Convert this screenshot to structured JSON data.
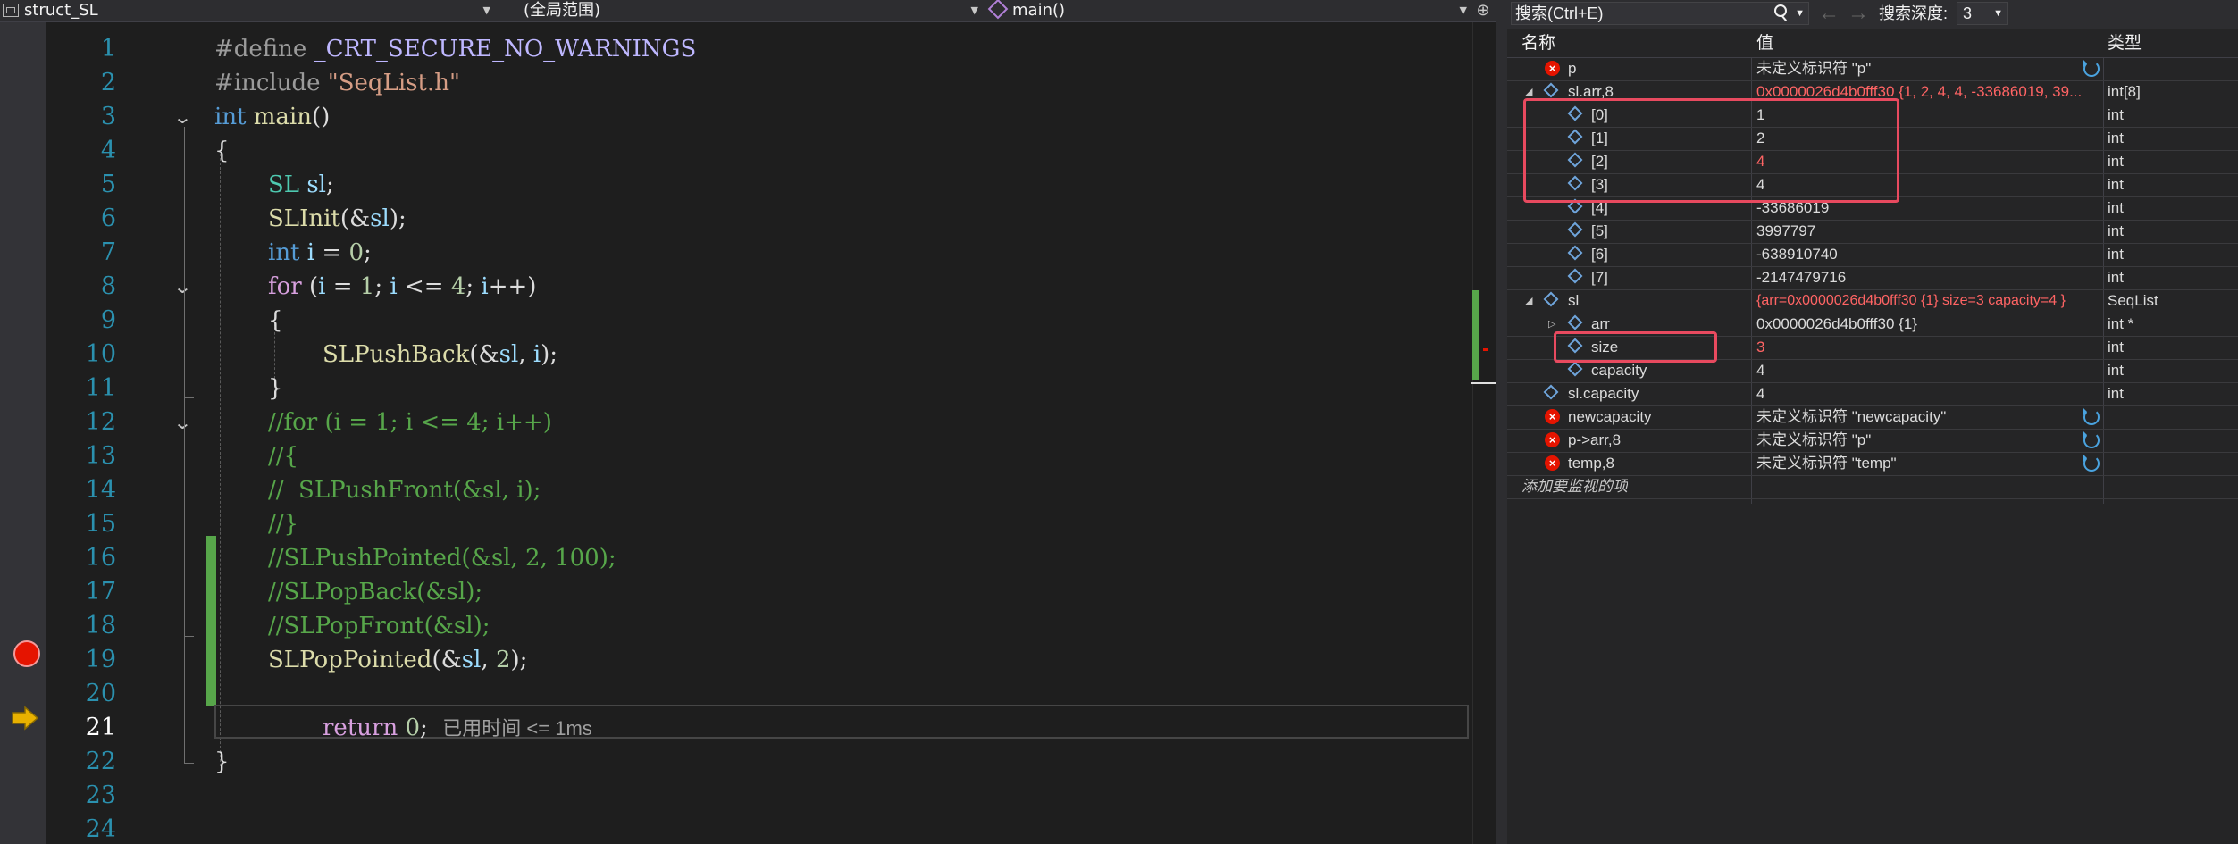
{
  "navigation": {
    "project": "struct_SL",
    "scope": "(全局范围)",
    "function": "main()"
  },
  "editor": {
    "line_numbers": [
      "1",
      "2",
      "3",
      "4",
      "5",
      "6",
      "7",
      "8",
      "9",
      "10",
      "11",
      "12",
      "13",
      "14",
      "15",
      "16",
      "17",
      "18",
      "19",
      "20",
      "21",
      "22",
      "23",
      "24"
    ],
    "current_line": "21",
    "breakpoint_line": "19",
    "elapsed": "已用时间 <= 1ms",
    "code": {
      "l1_define": "#define",
      "l1_macro": "_CRT_SECURE_NO_WARNINGS",
      "l2_include": "#include",
      "l2_file": "\"SeqList.h\"",
      "l3_type": "int",
      "l3_func": "main",
      "l3_rest": "()",
      "l4": "{",
      "l5_type": "SL",
      "l5_var": "sl",
      "l5_rest": ";",
      "l6_func": "SLInit",
      "l6_open": "(&",
      "l6_var": "sl",
      "l6_close": ");",
      "l7_type": "int",
      "l7_var": "i",
      "l7_eq": " = ",
      "l7_num": "0",
      "l7_end": ";",
      "l8_kw": "for",
      "l8_a": " (",
      "l8_i1": "i",
      "l8_b": " = ",
      "l8_n1": "1",
      "l8_c": "; ",
      "l8_i2": "i",
      "l8_d": " <= ",
      "l8_n2": "4",
      "l8_e": "; ",
      "l8_i3": "i",
      "l8_f": "++)",
      "l9": "{",
      "l10_func": "SLPushBack",
      "l10_open": "(&",
      "l10_var": "sl",
      "l10_comma": ", ",
      "l10_i": "i",
      "l10_close": ");",
      "l11": "}",
      "l12": "//for (i = 1; i <= 4; i++)",
      "l13": "//{",
      "l14": "//  SLPushFront(&sl, i);",
      "l15": "//}",
      "l16": "//SLPushPointed(&sl, 2, 100);",
      "l17": "//SLPopBack(&sl);",
      "l18": "//SLPopFront(&sl);",
      "l19_func": "SLPopPointed",
      "l19_open": "(&",
      "l19_var": "sl",
      "l19_comma": ", ",
      "l19_num": "2",
      "l19_close": ");",
      "l21_kw": "return",
      "l21_sp": " ",
      "l21_num": "0",
      "l21_end": ";",
      "l22": "}"
    }
  },
  "watch": {
    "search_placeholder": "搜索(Ctrl+E)",
    "depth_label": "搜索深度:",
    "depth_value": "3",
    "columns": {
      "name": "名称",
      "value": "值",
      "type": "类型"
    },
    "rows": [
      {
        "name": "p",
        "value": "未定义标识符 \"p\"",
        "type": "",
        "icon": "error"
      },
      {
        "name": "sl.arr,8",
        "value": "0x0000026d4b0fff30 {1, 2, 4, 4, -33686019, 39...",
        "type": "int[8]",
        "icon": "cube"
      },
      {
        "name": "[0]",
        "value": "1",
        "type": "int",
        "icon": "cube"
      },
      {
        "name": "[1]",
        "value": "2",
        "type": "int",
        "icon": "cube"
      },
      {
        "name": "[2]",
        "value": "4",
        "type": "int",
        "icon": "cube"
      },
      {
        "name": "[3]",
        "value": "4",
        "type": "int",
        "icon": "cube"
      },
      {
        "name": "[4]",
        "value": "-33686019",
        "type": "int",
        "icon": "cube"
      },
      {
        "name": "[5]",
        "value": "3997797",
        "type": "int",
        "icon": "cube"
      },
      {
        "name": "[6]",
        "value": "-638910740",
        "type": "int",
        "icon": "cube"
      },
      {
        "name": "[7]",
        "value": "-2147479716",
        "type": "int",
        "icon": "cube"
      },
      {
        "name": "sl",
        "value": "{arr=0x0000026d4b0fff30 {1} size=3 capacity=4 }",
        "type": "SeqList",
        "icon": "cube"
      },
      {
        "name": "arr",
        "value": "0x0000026d4b0fff30 {1}",
        "type": "int *",
        "icon": "cube"
      },
      {
        "name": "size",
        "value": "3",
        "type": "int",
        "icon": "cube"
      },
      {
        "name": "capacity",
        "value": "4",
        "type": "int",
        "icon": "cube"
      },
      {
        "name": "sl.capacity",
        "value": "4",
        "type": "int",
        "icon": "cube"
      },
      {
        "name": "newcapacity",
        "value": "未定义标识符 \"newcapacity\"",
        "type": "",
        "icon": "error"
      },
      {
        "name": "p->arr,8",
        "value": "未定义标识符 \"p\"",
        "type": "",
        "icon": "error"
      },
      {
        "name": "temp,8",
        "value": "未定义标识符 \"temp\"",
        "type": "",
        "icon": "error"
      }
    ],
    "add_watch": "添加要监视的项",
    "colors": {
      "changed_value": "#ff6464",
      "highlight_box": "#e84a5f"
    }
  }
}
